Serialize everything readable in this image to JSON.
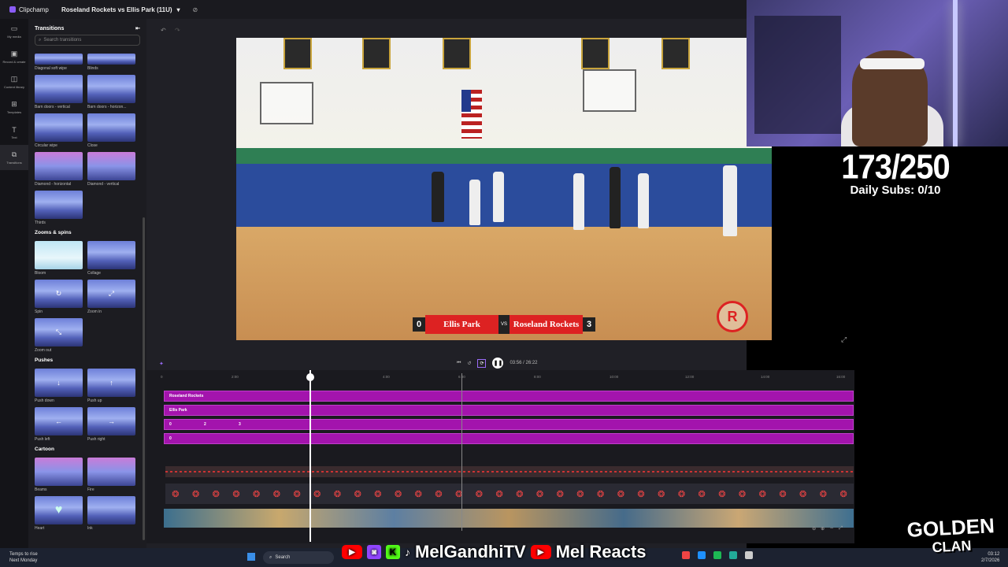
{
  "app": {
    "name": "Clipchamp",
    "project_title": "Roseland Rockets vs Ellis Park (11U)"
  },
  "rail": [
    {
      "label": "My media",
      "icon": "folder-icon"
    },
    {
      "label": "Record & create",
      "icon": "camera-icon"
    },
    {
      "label": "Content library",
      "icon": "library-icon"
    },
    {
      "label": "Templates",
      "icon": "templates-icon"
    },
    {
      "label": "Text",
      "icon": "text-icon"
    },
    {
      "label": "Transitions",
      "icon": "transitions-icon"
    }
  ],
  "panel": {
    "title": "Transitions",
    "search_placeholder": "Search transitions",
    "sections": [
      {
        "title": "",
        "items": [
          "Diagonal soft wipe",
          "Blinds",
          "Barn doors - vertical",
          "Barn doors - horizon...",
          "Circular wipe",
          "Close",
          "Diamond - horizontal",
          "Diamond - vertical",
          "Thirds"
        ]
      },
      {
        "title": "Zooms & spins",
        "items": [
          "Bloom",
          "Collage",
          "Spin",
          "Zoom in",
          "Zoom out"
        ]
      },
      {
        "title": "Pushes",
        "items": [
          "Push down",
          "Push up",
          "Push left",
          "Push right"
        ]
      },
      {
        "title": "Cartoon",
        "items": [
          "Beams",
          "Fire",
          "Heart",
          "Ink"
        ]
      }
    ]
  },
  "preview": {
    "scoreboard": {
      "home_score": "0",
      "home_team": "Ellis Park",
      "vs": "VS",
      "away_team": "Roseland Rockets",
      "away_score": "3"
    }
  },
  "player": {
    "current_time": "03:56",
    "total_time": "26:22",
    "time_display": "03:56 / 26:22"
  },
  "timeline": {
    "ruler": [
      "0",
      "2:00",
      "4:00",
      "6:00",
      "8:00",
      "10:00",
      "12:00",
      "14:00",
      "16:00",
      "18:00"
    ],
    "tracks": [
      {
        "label": "Roseland Rockets"
      },
      {
        "label": "Ellis Park"
      },
      {
        "label": "0",
        "label2": "2",
        "label3": "3"
      },
      {
        "label": "0"
      }
    ],
    "playhead_fraction": 0.149
  },
  "overlay": {
    "sub_count": "173/250",
    "daily_subs": "Daily Subs: 0/10",
    "handle": "MelGandhiTV",
    "handle2": "Mel Reacts",
    "brand_line1": "GOLDEN",
    "brand_line2": "CLAN"
  },
  "taskbar": {
    "weather_line1": "Temps to rise",
    "weather_line2": "Next Monday",
    "search": "Search",
    "time": "03:12",
    "date": "2/7/2026"
  }
}
